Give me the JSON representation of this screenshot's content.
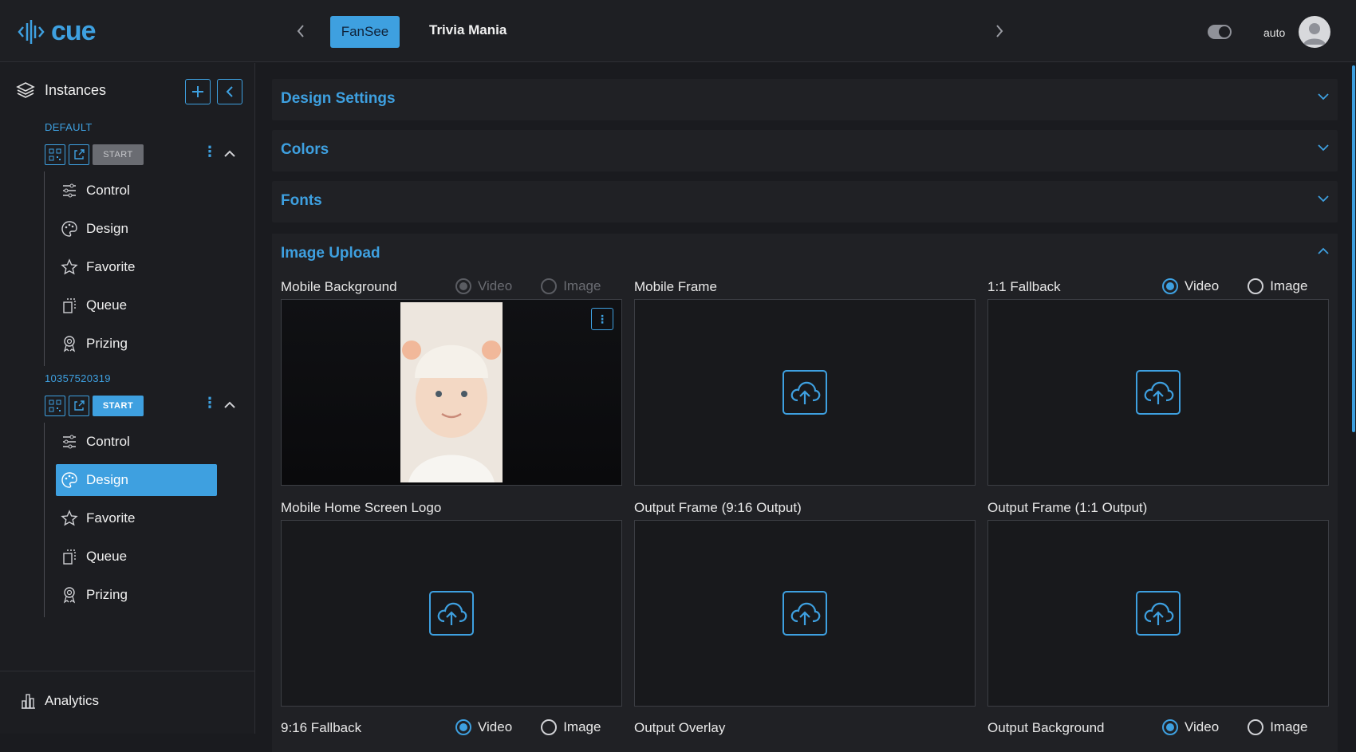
{
  "app": {
    "logo_text": "cue",
    "accent": "#3ea0e0"
  },
  "header": {
    "tabs": [
      {
        "label": "FanSee",
        "active": true
      },
      {
        "label": "Trivia Mania",
        "active": false
      }
    ],
    "theme_label": "auto"
  },
  "sidebar": {
    "title": "Instances",
    "instances": [
      {
        "name": "DEFAULT",
        "start_label": "START",
        "started": false,
        "items": [
          {
            "label": "Control",
            "icon": "sliders-icon"
          },
          {
            "label": "Design",
            "icon": "palette-icon"
          },
          {
            "label": "Favorite",
            "icon": "star-icon"
          },
          {
            "label": "Queue",
            "icon": "queue-icon"
          },
          {
            "label": "Prizing",
            "icon": "award-icon"
          }
        ]
      },
      {
        "name": "10357520319",
        "start_label": "START",
        "started": true,
        "items": [
          {
            "label": "Control",
            "icon": "sliders-icon"
          },
          {
            "label": "Design",
            "icon": "palette-icon",
            "active": true
          },
          {
            "label": "Favorite",
            "icon": "star-icon"
          },
          {
            "label": "Queue",
            "icon": "queue-icon"
          },
          {
            "label": "Prizing",
            "icon": "award-icon"
          }
        ]
      }
    ],
    "bottom_label": "Analytics"
  },
  "main": {
    "sections": [
      {
        "title": "Design Settings",
        "expanded": false
      },
      {
        "title": "Colors",
        "expanded": false
      },
      {
        "title": "Fonts",
        "expanded": false
      },
      {
        "title": "Image Upload",
        "expanded": true
      }
    ],
    "uploads": [
      {
        "label": "Mobile Background",
        "radio": {
          "video": "Video",
          "image": "Image",
          "selected": "video",
          "disabled": true
        },
        "has_image": true
      },
      {
        "label": "Mobile Frame"
      },
      {
        "label": "1:1 Fallback",
        "radio": {
          "video": "Video",
          "image": "Image",
          "selected": "video",
          "disabled": false
        }
      },
      {
        "label": "Mobile Home Screen Logo"
      },
      {
        "label": "Output Frame (9:16 Output)"
      },
      {
        "label": "Output Frame (1:1 Output)"
      },
      {
        "label": "9:16 Fallback",
        "radio": {
          "video": "Video",
          "image": "Image",
          "selected": "video",
          "disabled": false
        }
      },
      {
        "label": "Output Overlay"
      },
      {
        "label": "Output Background",
        "radio": {
          "video": "Video",
          "image": "Image",
          "selected": "video",
          "disabled": false
        }
      }
    ]
  }
}
